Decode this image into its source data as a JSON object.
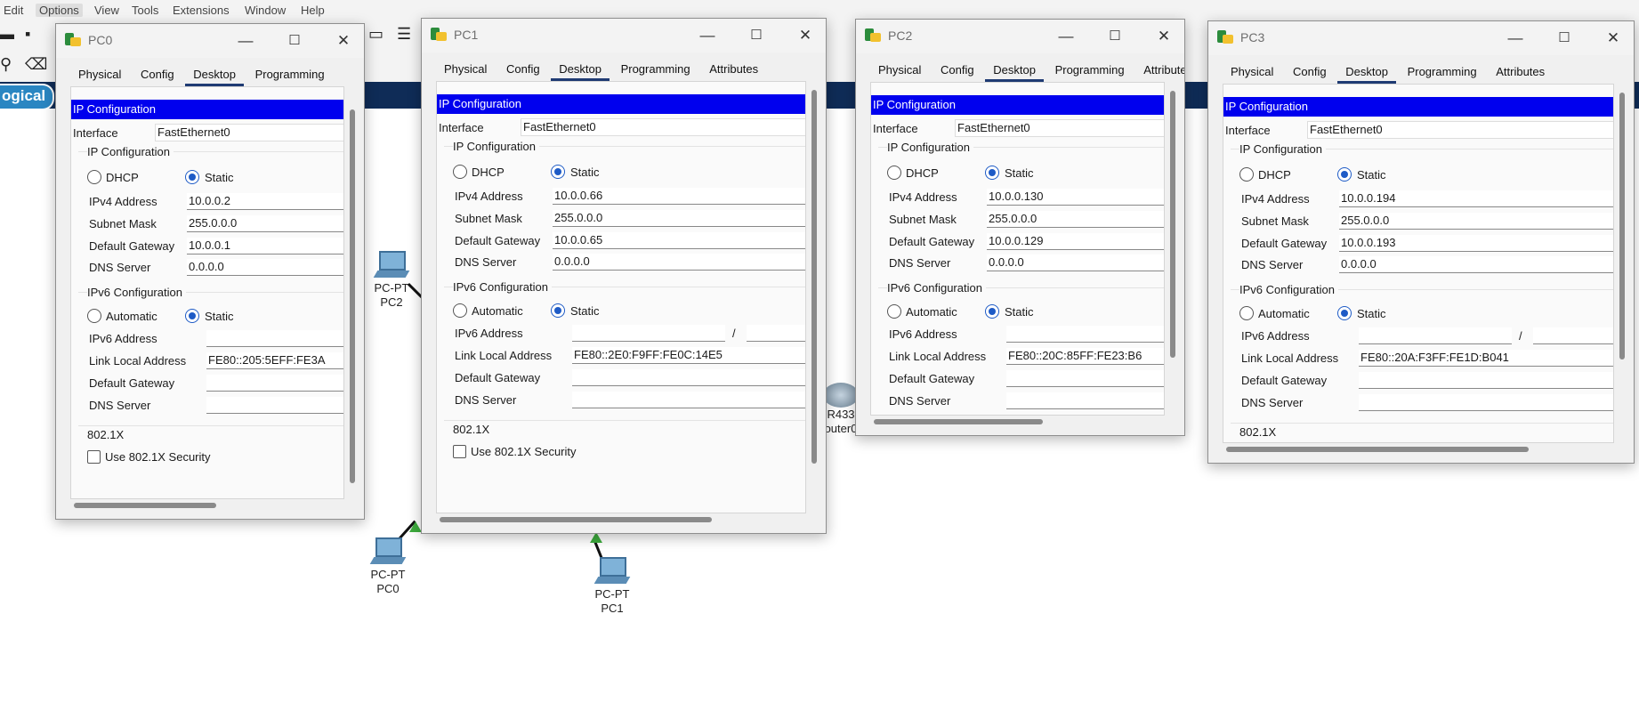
{
  "menubar": [
    "Edit",
    "Options",
    "View",
    "Tools",
    "Extensions",
    "Window",
    "Help"
  ],
  "workspace": {
    "logical_tab": "ogical"
  },
  "devices": {
    "pc0": [
      "PC-PT",
      "PC0"
    ],
    "pc1": [
      "PC-PT",
      "PC1"
    ],
    "pc2": [
      "PC-PT",
      "PC2"
    ],
    "router": [
      "R433",
      "outer0"
    ]
  },
  "tabs_common": [
    "Physical",
    "Config",
    "Desktop",
    "Programming",
    "Attributes"
  ],
  "labels": {
    "ip_configuration": "IP Configuration",
    "interface": "Interface",
    "dhcp": "DHCP",
    "static": "Static",
    "ipv4_address": "IPv4 Address",
    "subnet_mask": "Subnet Mask",
    "default_gateway": "Default Gateway",
    "dns_server": "DNS Server",
    "ipv6_configuration": "IPv6 Configuration",
    "automatic": "Automatic",
    "ipv6_address": "IPv6 Address",
    "link_local": "Link Local Address",
    "dot1x": "802.1X",
    "use_dot1x": "Use 802.1X Security",
    "slash": "/"
  },
  "windows": [
    {
      "title": "PC0",
      "interface": "FastEthernet0",
      "ipv4": "10.0.0.2",
      "mask": "255.0.0.0",
      "gateway": "10.0.0.1",
      "dns": "0.0.0.0",
      "link_local": "FE80::205:5EFF:FE3A",
      "ipv6_address": "",
      "ipv6_gateway": "",
      "ipv6_dns": ""
    },
    {
      "title": "PC1",
      "interface": "FastEthernet0",
      "ipv4": "10.0.0.66",
      "mask": "255.0.0.0",
      "gateway": "10.0.0.65",
      "dns": "0.0.0.0",
      "link_local": "FE80::2E0:F9FF:FE0C:14E5",
      "ipv6_address": "",
      "ipv6_gateway": "",
      "ipv6_dns": ""
    },
    {
      "title": "PC2",
      "interface": "FastEthernet0",
      "ipv4": "10.0.0.130",
      "mask": "255.0.0.0",
      "gateway": "10.0.0.129",
      "dns": "0.0.0.0",
      "link_local": "FE80::20C:85FF:FE23:B6",
      "ipv6_address": "",
      "ipv6_gateway": "",
      "ipv6_dns": ""
    },
    {
      "title": "PC3",
      "interface": "FastEthernet0",
      "ipv4": "10.0.0.194",
      "mask": "255.0.0.0",
      "gateway": "10.0.0.193",
      "dns": "0.0.0.0",
      "link_local": "FE80::20A:F3FF:FE1D:B041",
      "ipv6_address": "",
      "ipv6_gateway": "",
      "ipv6_dns": ""
    }
  ],
  "window_controls": {
    "minimize": "—",
    "maximize": "☐",
    "close": "✕"
  }
}
